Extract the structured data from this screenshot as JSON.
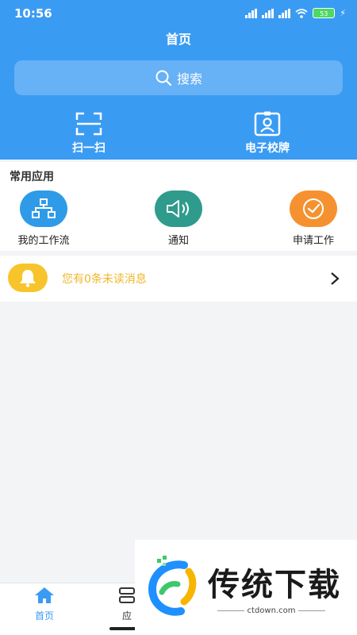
{
  "status_bar": {
    "time": "10:56",
    "battery": "53"
  },
  "header": {
    "title": "首页"
  },
  "search": {
    "label": "搜索"
  },
  "quick_actions": [
    {
      "label": "扫一扫",
      "icon": "scan-icon"
    },
    {
      "label": "电子校牌",
      "icon": "badge-icon"
    }
  ],
  "apps": {
    "title": "常用应用",
    "items": [
      {
        "label": "我的工作流",
        "icon": "workflow-icon",
        "color": "#2f9be8"
      },
      {
        "label": "通知",
        "icon": "speaker-icon",
        "color": "#2f9b8c"
      },
      {
        "label": "申请工作",
        "icon": "check-icon",
        "color": "#f5922f"
      }
    ]
  },
  "notice": {
    "text": "您有0条未读消息",
    "icon": "bell-icon"
  },
  "tabbar": {
    "tabs": [
      {
        "label": "首页",
        "icon": "home-icon",
        "active": true
      },
      {
        "label": "应",
        "icon": "apps-icon",
        "active": false
      }
    ]
  },
  "watermark": {
    "name": "传统下载",
    "url": "ctdown.com"
  },
  "colors": {
    "primary": "#3a9bf3",
    "notice_text": "#f0b62a"
  }
}
